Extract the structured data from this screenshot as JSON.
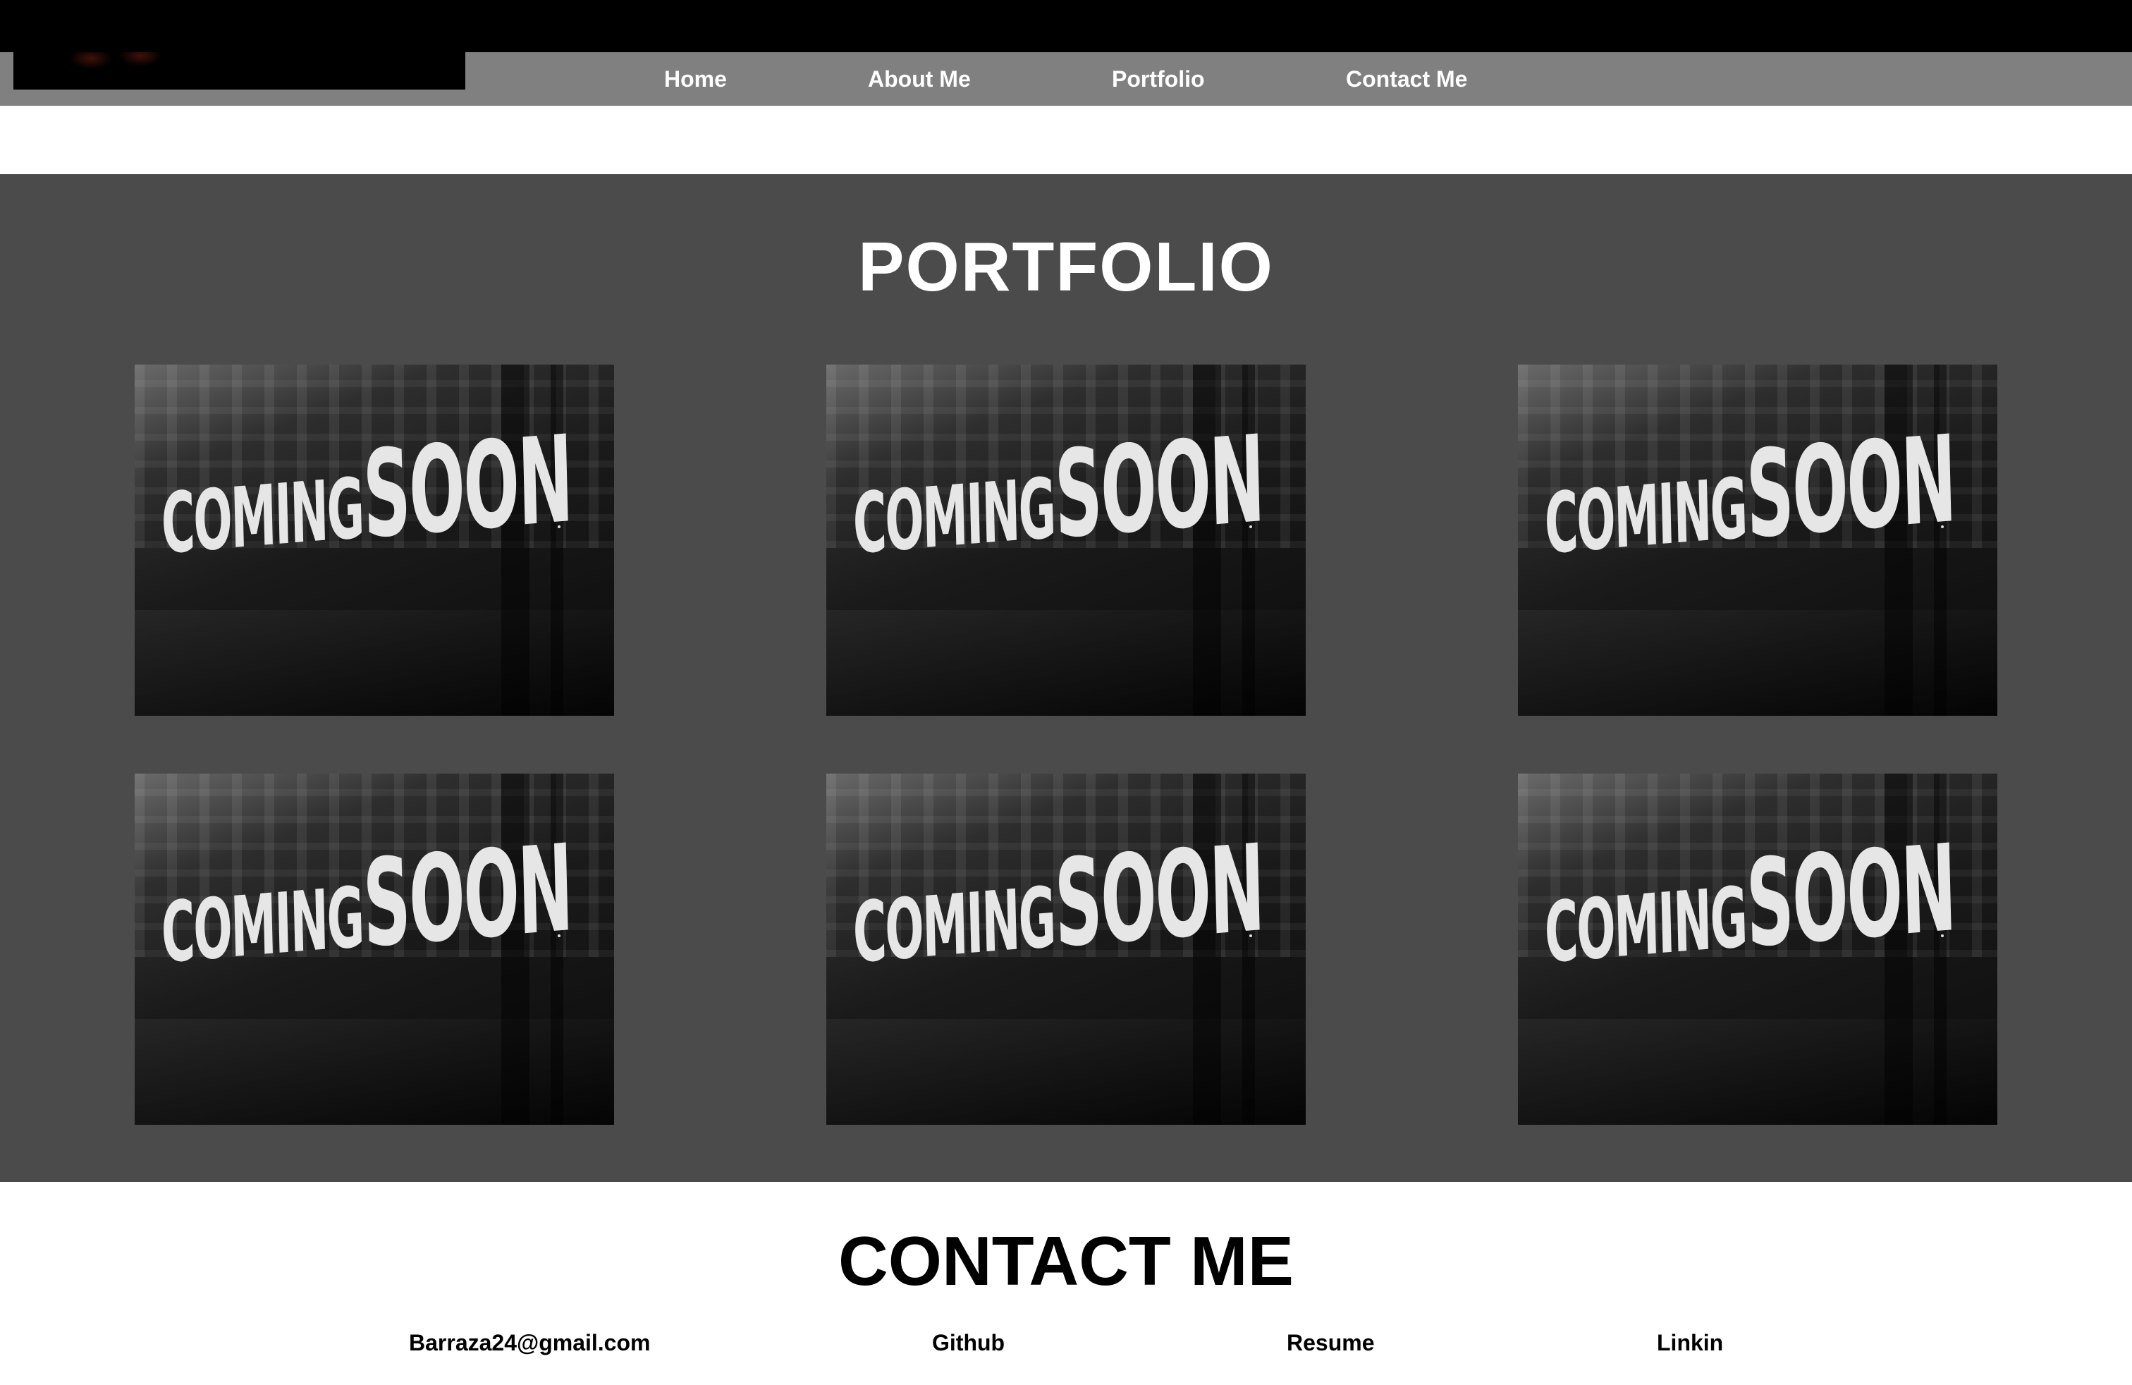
{
  "nav": {
    "items": [
      {
        "label": "Home"
      },
      {
        "label": "About Me"
      },
      {
        "label": "Portfolio"
      },
      {
        "label": "Contact Me"
      }
    ]
  },
  "portfolio": {
    "title": "PORTFOLIO",
    "cards": [
      {
        "sign_line1": "COMING",
        "sign_line2": "SOON"
      },
      {
        "sign_line1": "COMING",
        "sign_line2": "SOON"
      },
      {
        "sign_line1": "COMING",
        "sign_line2": "SOON"
      },
      {
        "sign_line1": "COMING",
        "sign_line2": "SOON"
      },
      {
        "sign_line1": "COMING",
        "sign_line2": "SOON"
      },
      {
        "sign_line1": "COMING",
        "sign_line2": "SOON"
      }
    ]
  },
  "contact": {
    "title": "CONTACT ME",
    "links": [
      {
        "label": "Barraza24@gmail.com"
      },
      {
        "label": "Github"
      },
      {
        "label": "Resume"
      },
      {
        "label": "Linkin"
      }
    ]
  },
  "colors": {
    "top_strip": "#000000",
    "navbar": "#808080",
    "portfolio_bg": "#4b4b4b",
    "page_bg": "#ffffff",
    "heading_light": "#ffffff",
    "heading_dark": "#000000"
  }
}
